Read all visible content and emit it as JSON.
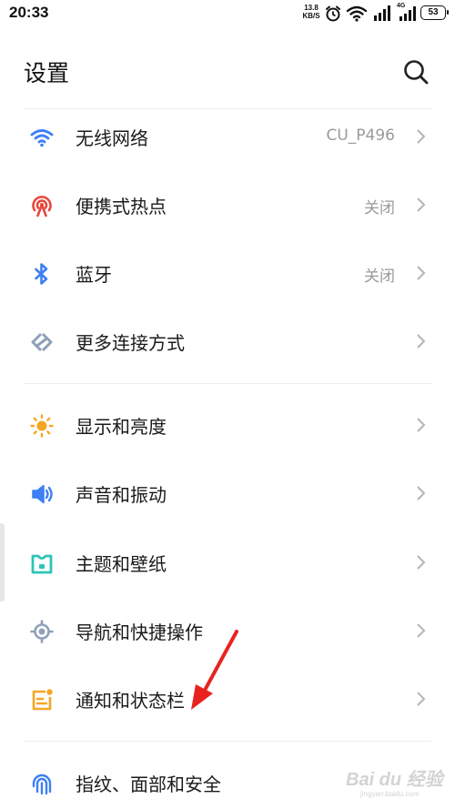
{
  "status_bar": {
    "time": "20:33",
    "net_speed_value": "13.8",
    "net_speed_unit": "KB/S",
    "network_type": "4G",
    "battery": "53",
    "icons": [
      "alarm-icon",
      "wifi-icon",
      "signal-icon",
      "signal-4g-icon",
      "battery-icon"
    ]
  },
  "header": {
    "title": "设置",
    "search_icon": "search-icon"
  },
  "settings": [
    {
      "label": "无线网络",
      "value": "CU_P496",
      "icon": "wifi-icon",
      "color": "#3d7ff5"
    },
    {
      "label": "便携式热点",
      "value": "关闭",
      "icon": "hotspot-icon",
      "color": "#e8473b"
    },
    {
      "label": "蓝牙",
      "value": "关闭",
      "icon": "bluetooth-icon",
      "color": "#3d7ff5"
    },
    {
      "label": "更多连接方式",
      "value": "",
      "icon": "more-connections-icon",
      "color": "#8fa0b8"
    },
    {
      "label": "显示和亮度",
      "value": "",
      "icon": "sun-icon",
      "color": "#f5a623"
    },
    {
      "label": "声音和振动",
      "value": "",
      "icon": "speaker-icon",
      "color": "#3d7ff5"
    },
    {
      "label": "主题和壁纸",
      "value": "",
      "icon": "theme-icon",
      "color": "#2ec4b6"
    },
    {
      "label": "导航和快捷操作",
      "value": "",
      "icon": "navigation-icon",
      "color": "#8fa0b8"
    },
    {
      "label": "通知和状态栏",
      "value": "",
      "icon": "notification-icon",
      "color": "#f5a623"
    },
    {
      "label": "指纹、面部和安全",
      "value": "",
      "icon": "fingerprint-icon",
      "color": "#3d7ff5"
    }
  ],
  "annotation": {
    "arrow_color": "#e8231f"
  },
  "watermark": {
    "text": "Bai du 经验",
    "sub": "jingyan.baidu.com"
  }
}
